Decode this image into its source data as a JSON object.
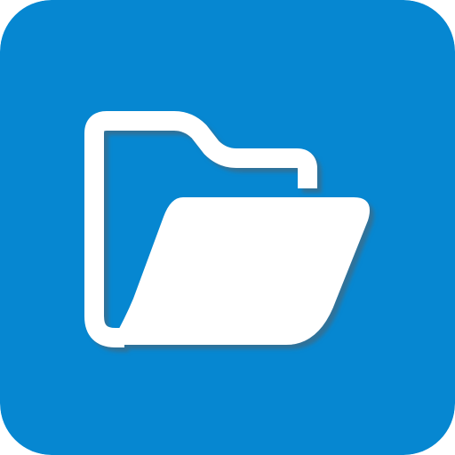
{
  "app_icon": {
    "icon": "folder-open-icon",
    "background_color": "#0687D1",
    "foreground_color": "#FFFFFF",
    "shadow_color": "#3C6A87"
  }
}
